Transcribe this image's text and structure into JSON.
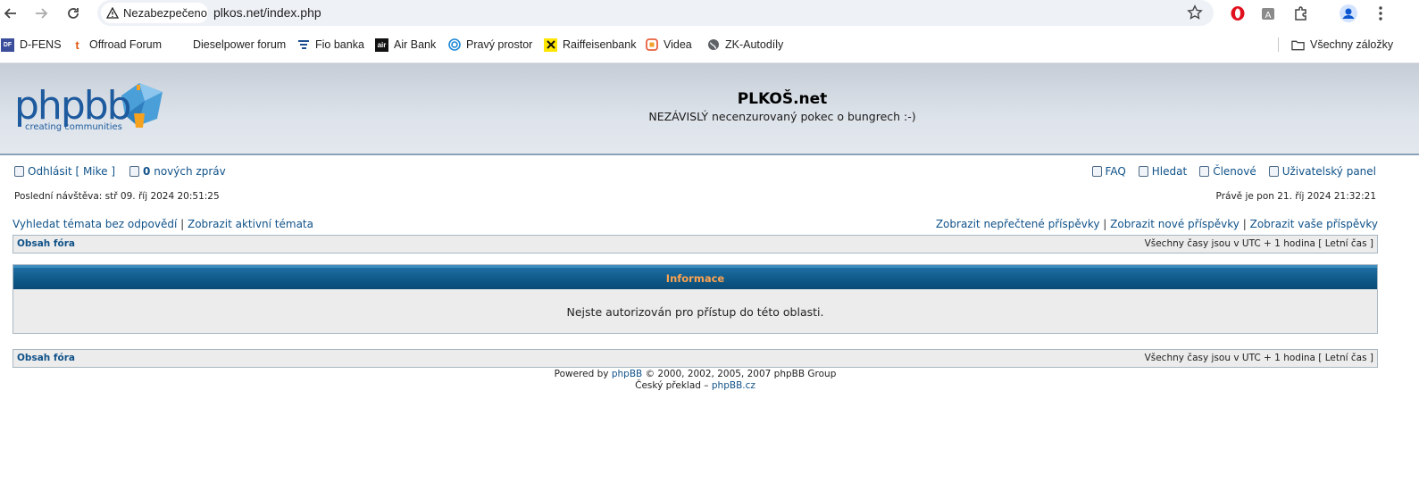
{
  "browser": {
    "security_label": "Nezabezpečeno",
    "url": "plkos.net/index.php",
    "bookmarks": [
      {
        "label": "D-FENS",
        "icon": "d-fens-favicon"
      },
      {
        "label": "Offroad Forum",
        "icon": "offroad-favicon"
      },
      {
        "label": "Dieselpower forum",
        "icon": "none"
      },
      {
        "label": "Fio banka",
        "icon": "fio-favicon"
      },
      {
        "label": "Air Bank",
        "icon": "airbank-favicon"
      },
      {
        "label": "Pravý prostor",
        "icon": "pravy-prostor-favicon"
      },
      {
        "label": "Raiffeisenbank",
        "icon": "raiffeisen-favicon"
      },
      {
        "label": "Videa",
        "icon": "videa-favicon"
      },
      {
        "label": "ZK-Autodíly",
        "icon": "globe-icon"
      }
    ],
    "all_bookmarks_label": "Všechny záložky"
  },
  "header": {
    "site_title": "PLKOŠ.net",
    "site_description": "NEZÁVISLÝ necenzurovaný pokec o bungrech :-)",
    "logo_main": "phpbb",
    "logo_tagline": "creating communities"
  },
  "userbar": {
    "logout_label": "Odhlásit [ Mike ]",
    "new_messages_count": "0",
    "new_messages_label": "nových zpráv",
    "faq_label": "FAQ",
    "search_label": "Hledat",
    "members_label": "Členové",
    "ucp_label": "Uživatelský panel",
    "last_visit": "Poslední návštěva: stř 09. říj 2024 20:51:25",
    "current_time": "Právě je pon 21. říj 2024 21:32:21"
  },
  "search_links": {
    "unanswered": "Vyhledat témata bez odpovědí",
    "active": "Zobrazit aktivní témata",
    "unread": "Zobrazit nepřečtené příspěvky",
    "new_posts": "Zobrazit nové příspěvky",
    "your_posts": "Zobrazit vaše příspěvky",
    "separator": "|"
  },
  "navbar": {
    "index_label": "Obsah fóra",
    "timezone": "Všechny časy jsou v UTC + 1 hodina [ Letní čas ]"
  },
  "info_panel": {
    "title": "Informace",
    "message": "Nejste autorizován pro přístup do této oblasti."
  },
  "footer": {
    "powered_prefix": "Powered by",
    "phpbb_link": "phpBB",
    "copyright": "© 2000, 2002, 2005, 2007 phpBB Group",
    "translation_prefix": "Český překlad –",
    "translation_link": "phpBB.cz"
  },
  "colors": {
    "link": "#105289",
    "panel_header": "#0f5b8a",
    "panel_title": "#ffa34f",
    "header_bg": "#d3d9e1"
  }
}
